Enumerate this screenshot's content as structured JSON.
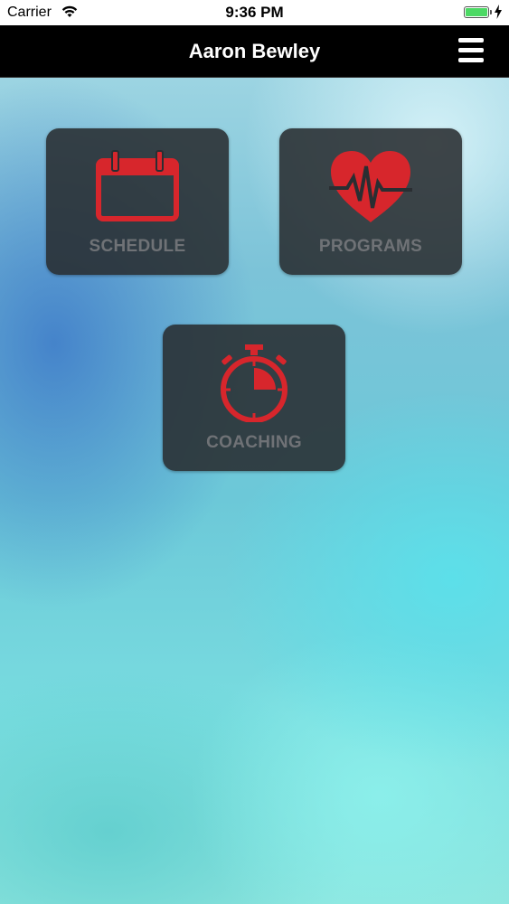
{
  "status_bar": {
    "carrier": "Carrier",
    "time": "9:36 PM",
    "battery_color": "#4cd964"
  },
  "nav": {
    "title": "Aaron Bewley",
    "menu_icon": "hamburger-menu-icon"
  },
  "tiles": [
    {
      "label": "SCHEDULE",
      "icon": "calendar-icon"
    },
    {
      "label": "PROGRAMS",
      "icon": "heartbeat-icon"
    },
    {
      "label": "COACHING",
      "icon": "stopwatch-icon"
    }
  ],
  "colors": {
    "accent": "#d7262c",
    "tile_bg": "#2a2e32",
    "tile_label": "#6f7276",
    "nav_bg": "#000000"
  }
}
